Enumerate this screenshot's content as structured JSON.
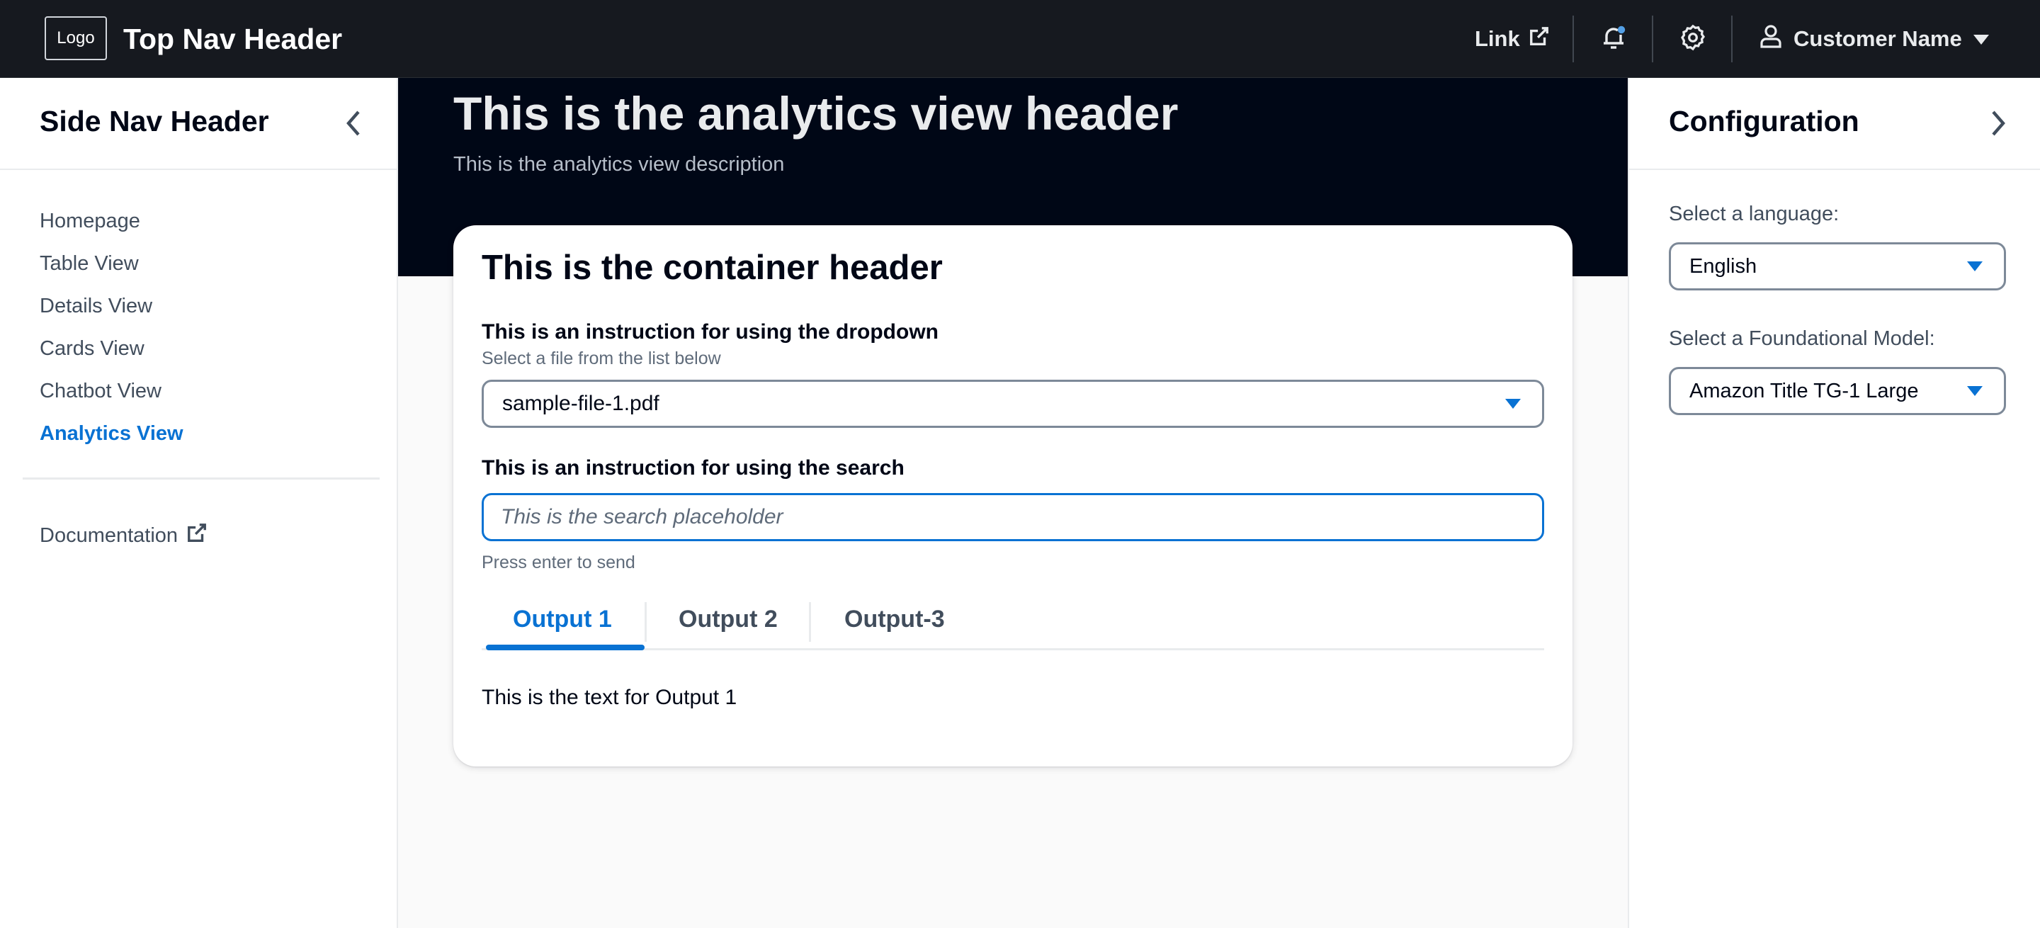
{
  "topnav": {
    "logo": "Logo",
    "title": "Top Nav Header",
    "link_label": "Link",
    "user_name": "Customer Name",
    "icons": [
      "external-link-icon",
      "bell-icon",
      "gear-icon",
      "user-icon",
      "caret-down-icon"
    ]
  },
  "sidenav": {
    "header": "Side Nav Header",
    "items": [
      {
        "label": "Homepage"
      },
      {
        "label": "Table View"
      },
      {
        "label": "Details View"
      },
      {
        "label": "Cards View"
      },
      {
        "label": "Chatbot View"
      },
      {
        "label": "Analytics View",
        "active": true
      }
    ],
    "doc_link": "Documentation"
  },
  "main": {
    "title": "This is the analytics view header",
    "description": "This is the analytics view description",
    "container": {
      "header": "This is the container header",
      "dropdown_instruction": "This is an instruction for using the dropdown",
      "dropdown_description": "Select a file from the list below",
      "dropdown_value": "sample-file-1.pdf",
      "search_instruction": "This is an instruction for using the search",
      "search_placeholder": "This is the search placeholder",
      "search_hint": "Press enter to send",
      "tabs": [
        {
          "label": "Output 1",
          "active": true
        },
        {
          "label": "Output 2"
        },
        {
          "label": "Output-3"
        }
      ],
      "tab_content": "This is the text for Output 1"
    }
  },
  "config": {
    "title": "Configuration",
    "language_label": "Select a language:",
    "language_value": "English",
    "model_label": "Select a Foundational Model:",
    "model_value": "Amazon Title TG-1 Large"
  },
  "colors": {
    "topnav_bg": "#16191f",
    "hero_bg": "#000716",
    "accent": "#0972d3",
    "notification_dot": "#539fe5"
  }
}
